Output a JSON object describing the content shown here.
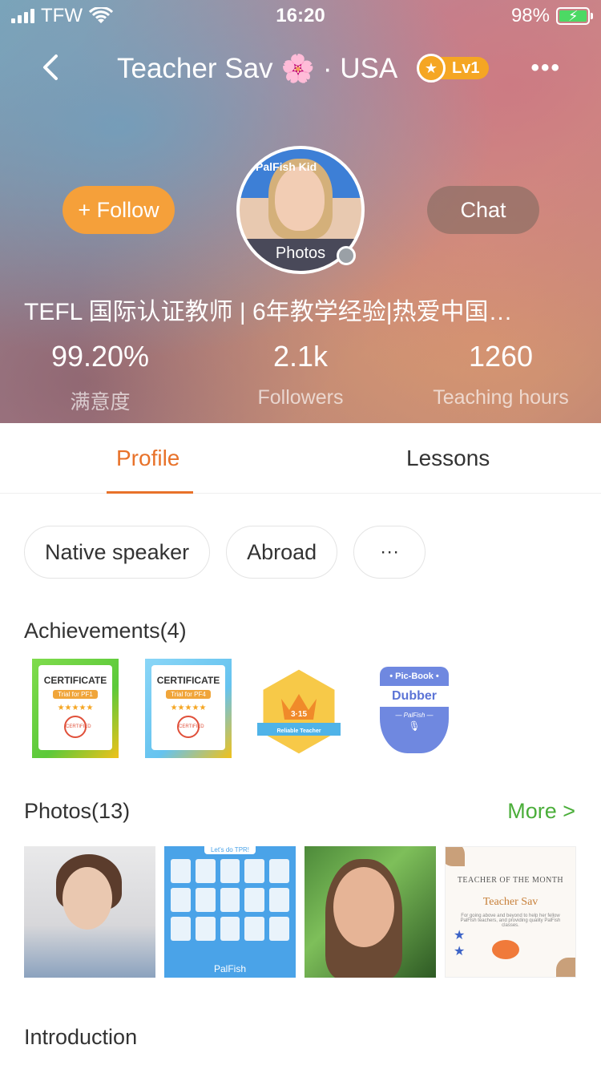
{
  "status_bar": {
    "carrier": "TFW",
    "time": "16:20",
    "battery": "98%"
  },
  "header": {
    "title": "Teacher Sav",
    "flag_emoji": "🌸",
    "country": "· USA",
    "level": "Lv1"
  },
  "profile": {
    "follow_label": "+ Follow",
    "chat_label": "Chat",
    "avatar_label": "Photos",
    "avatar_brand": "PalFish Kid",
    "bio": "TEFL 国际认证教师 | 6年教学经验|热爱中国…"
  },
  "stats": [
    {
      "value": "99.20%",
      "label": "满意度"
    },
    {
      "value": "2.1k",
      "label": "Followers"
    },
    {
      "value": "1260",
      "label": "Teaching hours"
    }
  ],
  "tabs": [
    {
      "label": "Profile",
      "active": true
    },
    {
      "label": "Lessons",
      "active": false
    }
  ],
  "chips": [
    "Native speaker",
    "Abroad",
    "···"
  ],
  "achievements": {
    "title": "Achievements(4)",
    "items": [
      {
        "heading": "CERTIFICATE",
        "sub": "Trial for PF1",
        "seal": "CERTIFIED"
      },
      {
        "heading": "CERTIFICATE",
        "sub": "Trial for PF4",
        "seal": "CERTIFIED"
      },
      {
        "num": "3·15",
        "ribbon": "Reliable Teacher"
      },
      {
        "top": "• Pic-Book •",
        "main": "Dubber",
        "sub": "— PalFish —"
      }
    ]
  },
  "photos": {
    "title": "Photos(13)",
    "more": "More >",
    "tpr_title": "Let's do TPR!",
    "palfish": "PalFish",
    "certificate_heading": "TEACHER OF THE MONTH",
    "certificate_name": "Teacher Sav",
    "certificate_text": "For going above and beyond to help her fellow PalFish teachers, and providing quality PalFish classes."
  },
  "introduction": {
    "title": "Introduction"
  },
  "colors": {
    "accent": "#e8722a",
    "follow": "#f5a03a",
    "more_link": "#4bae3a"
  },
  "icons": {
    "back": "chevron-left-icon",
    "more": "more-horizontal-icon",
    "medal": "medal-icon",
    "wifi": "wifi-icon",
    "signal": "signal-icon",
    "battery": "battery-icon"
  }
}
